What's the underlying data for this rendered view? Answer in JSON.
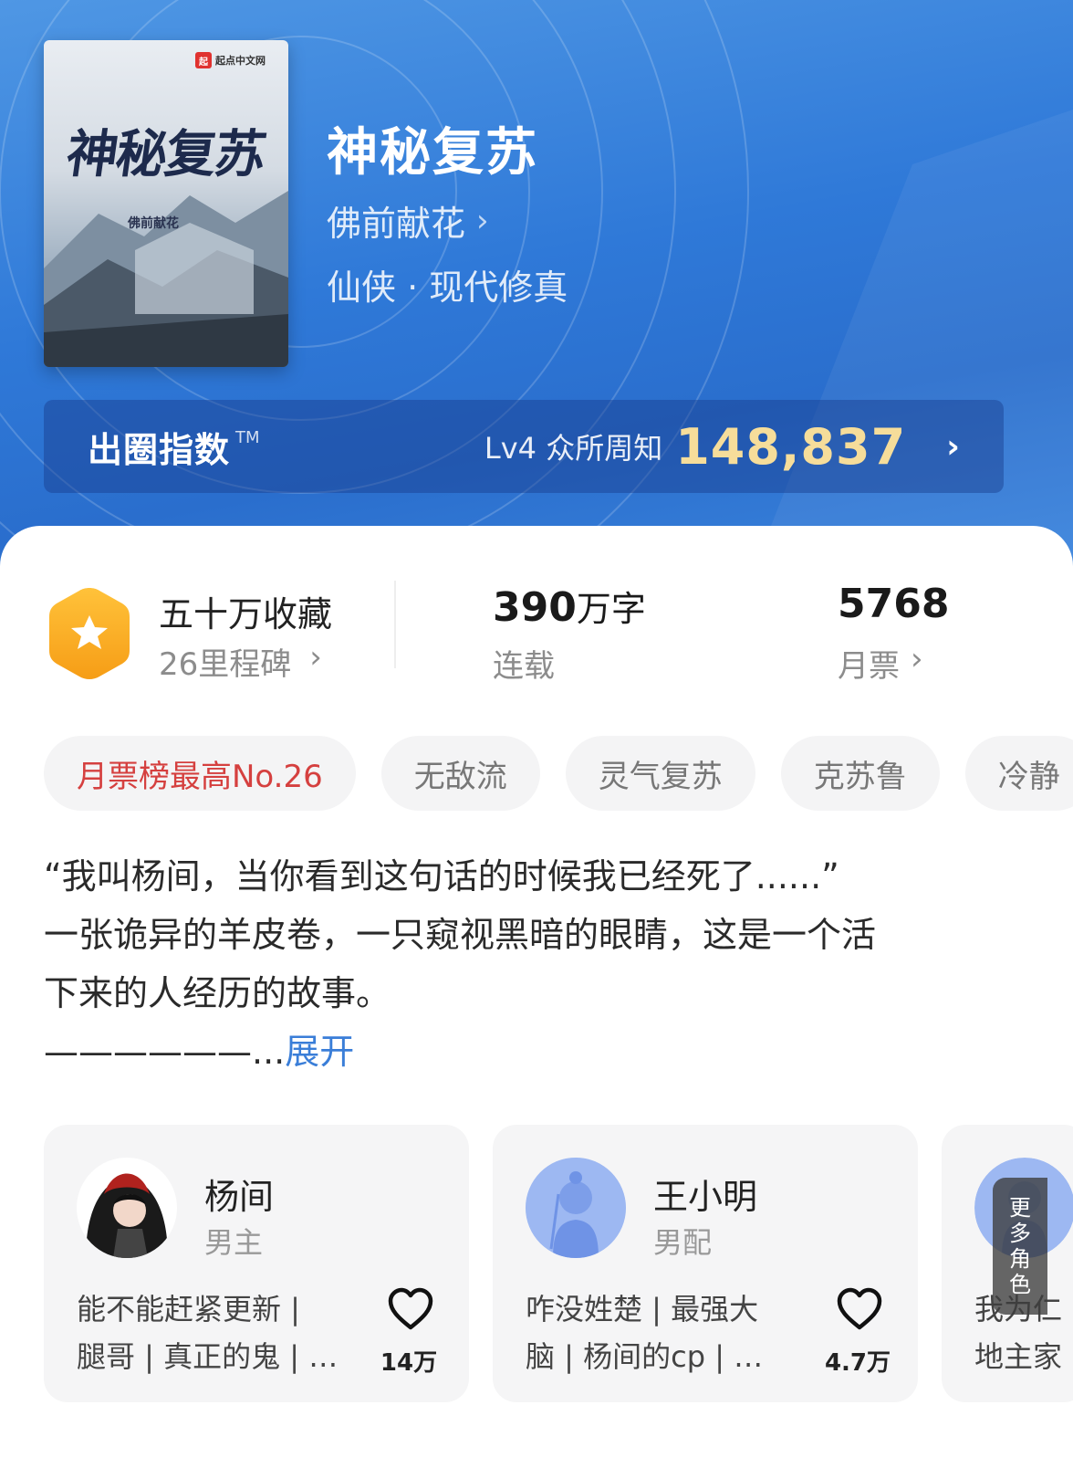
{
  "book": {
    "title": "神秘复苏",
    "author": "佛前献花",
    "genre": "仙侠 · 现代修真",
    "cover": {
      "publisher": "起点中文网",
      "publisher_badge": "起",
      "title": "神秘复苏",
      "author": "佛前献花"
    }
  },
  "popularity": {
    "label": "出圈指数",
    "tm": "TM",
    "level": "Lv4 众所周知",
    "value": "148,837"
  },
  "stats": {
    "collect_title": "五十万收藏",
    "collect_sub": "26里程碑",
    "word_count": "390",
    "word_unit": "万字",
    "status": "连载",
    "monthly_votes": "5768",
    "monthly_label": "月票"
  },
  "tags": [
    "月票榜最高No.26",
    "无敌流",
    "灵气复苏",
    "克苏鲁",
    "冷静"
  ],
  "description": {
    "line1": "“我叫杨间，当你看到这句话的时候我已经死了......”",
    "line2": "一张诡异的羊皮卷，一只窥视黑暗的眼睛，这是一个活",
    "line3": "下来的人经历的故事。",
    "line4": "——————...",
    "expand": "展开"
  },
  "characters": [
    {
      "name": "杨间",
      "role": "男主",
      "tags_line1": "能不能赶紧更新 |",
      "tags_line2": "腿哥 | 真正的鬼 | …",
      "likes": "14万"
    },
    {
      "name": "王小明",
      "role": "男配",
      "tags_line1": "咋没姓楚 | 最强大",
      "tags_line2": "脑 | 杨间的cp | …",
      "likes": "4.7万"
    },
    {
      "tags_line1": "我为仁",
      "tags_line2": "地主家"
    }
  ],
  "more_roles": "更多角色",
  "colors": {
    "header_blue": "#2f79d8",
    "gold": "#f6dd9a",
    "hot_tag": "#d5403f",
    "link_blue": "#3a7ed8",
    "badge_orange": "#f9a825"
  }
}
